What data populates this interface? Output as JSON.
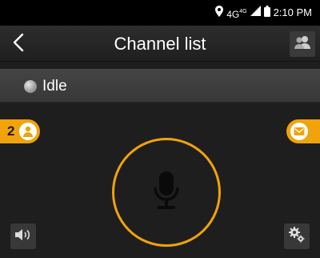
{
  "status_bar": {
    "network": "4G",
    "network_super": "4G",
    "time": "2:10 PM"
  },
  "header": {
    "title": "Channel list"
  },
  "channel_status": {
    "label": "Idle"
  },
  "members": {
    "count": "2"
  },
  "colors": {
    "accent": "#f0a30a",
    "background": "#1e1e1e",
    "status_bar": "#000000"
  },
  "icons": [
    "location-icon",
    "signal-icon",
    "battery-icon",
    "back-icon",
    "users-icon",
    "members-icon",
    "message-icon",
    "microphone-icon",
    "volume-icon",
    "settings-icon"
  ]
}
